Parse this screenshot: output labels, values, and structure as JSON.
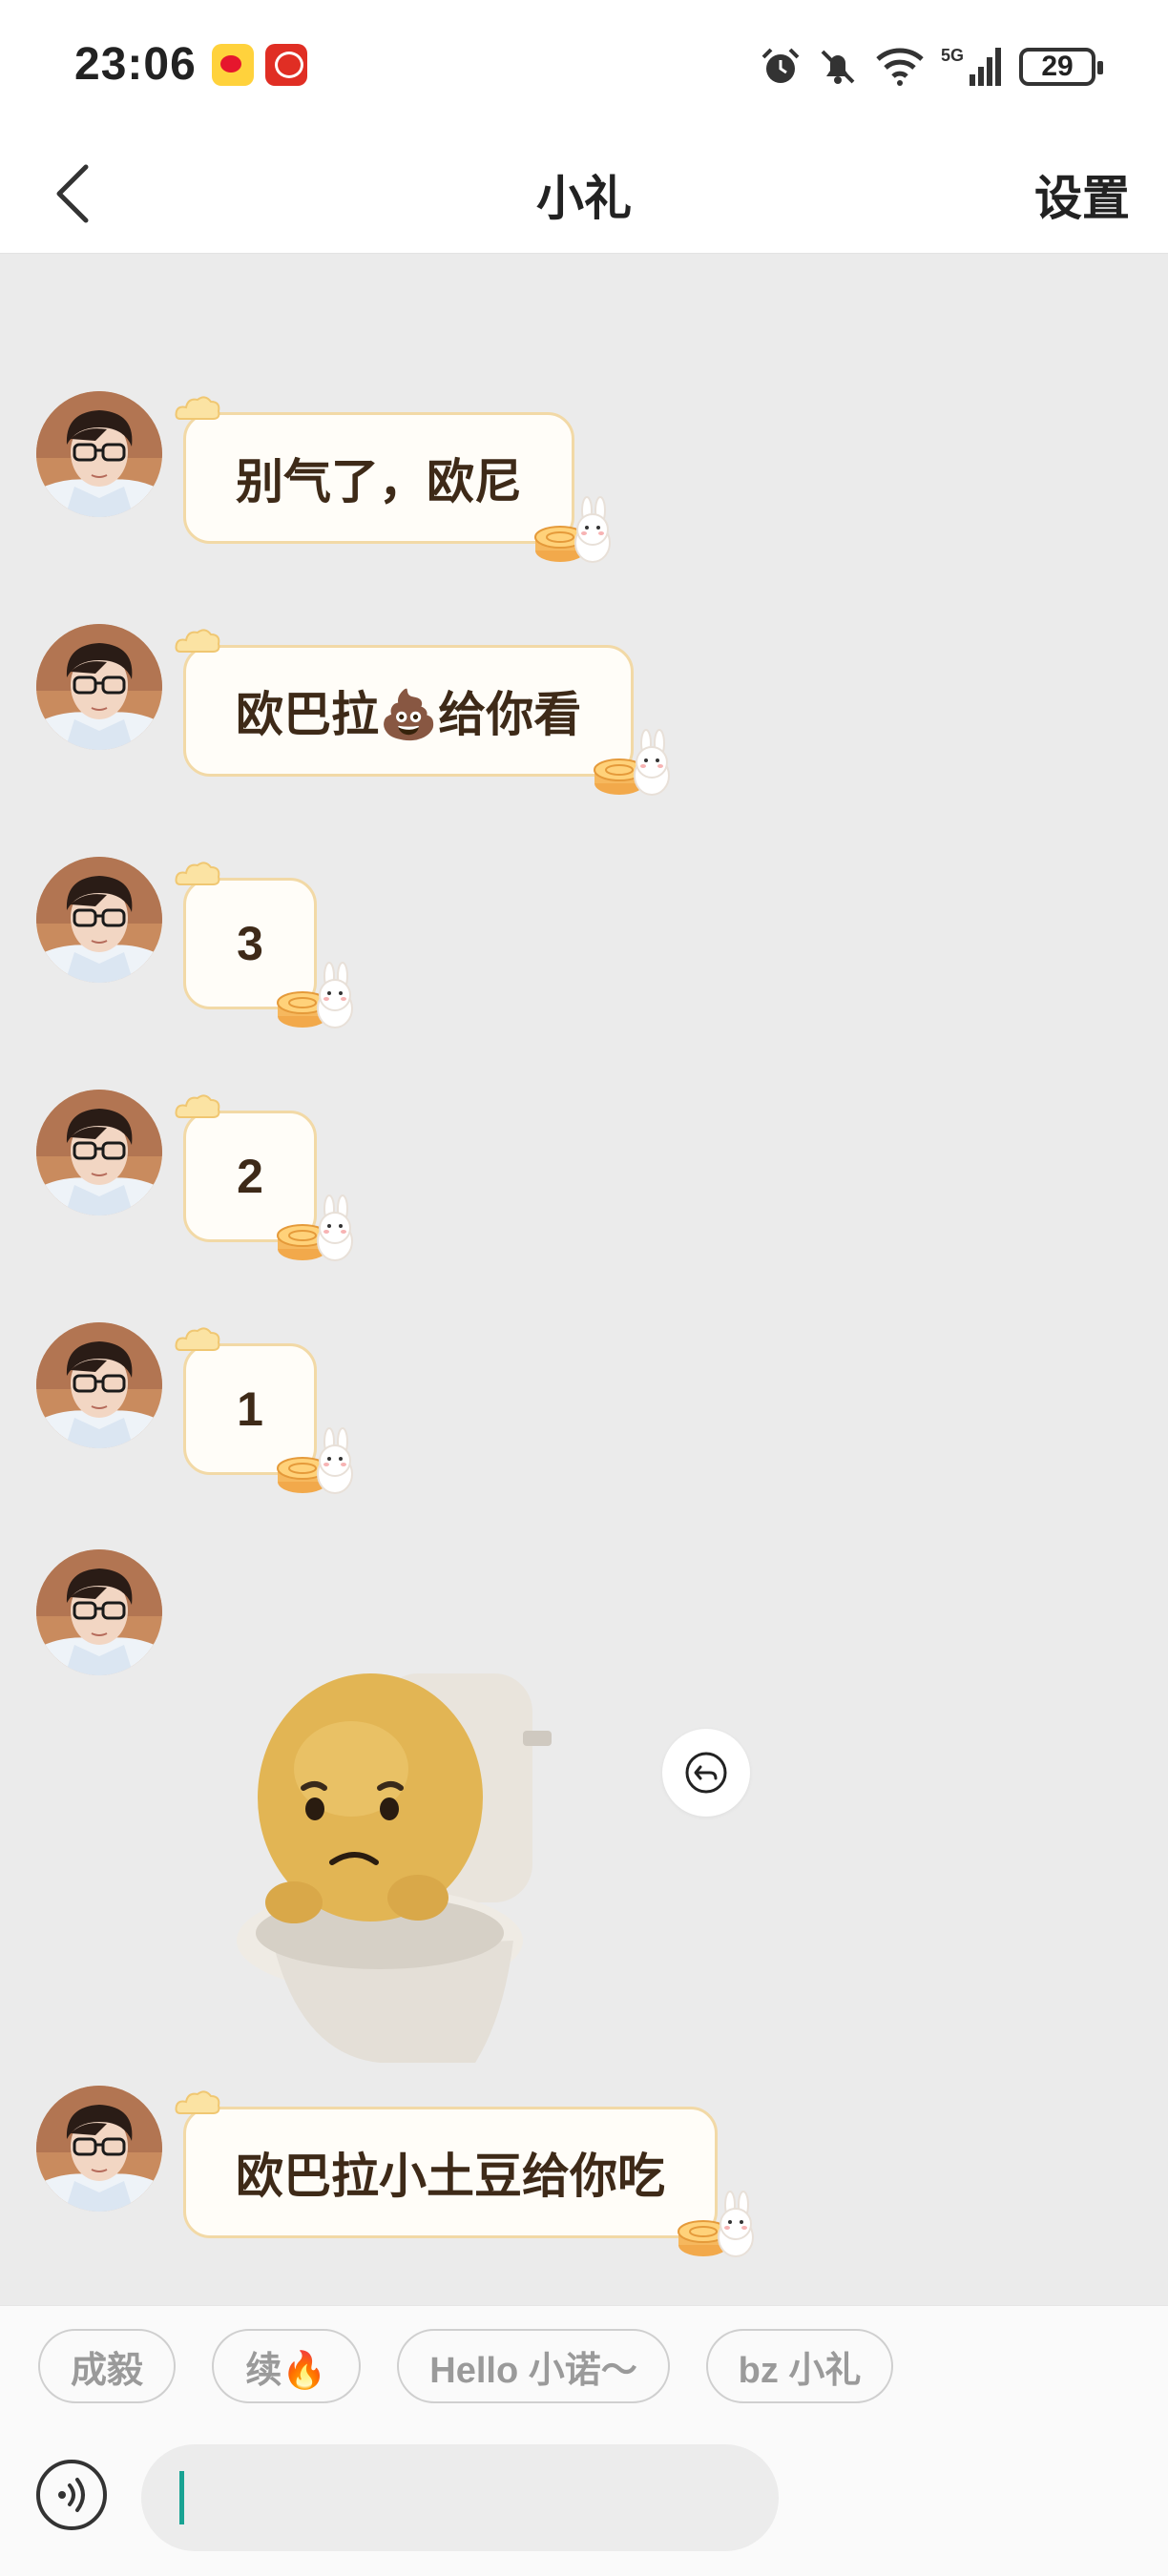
{
  "status_bar": {
    "time": "23:06",
    "battery": "29",
    "network": "5G",
    "notification_icons": [
      "weibo-app-icon",
      "pinduoduo-app-icon"
    ],
    "system_icons": [
      "alarm-icon",
      "mute-icon",
      "wifi-icon",
      "signal-icon",
      "battery-icon"
    ]
  },
  "header": {
    "title": "小礼",
    "settings_label": "设置"
  },
  "messages": [
    {
      "type": "text",
      "text": "别气了，欧尼"
    },
    {
      "type": "text",
      "text": "欧巴拉💩给你看"
    },
    {
      "type": "text",
      "text": "3"
    },
    {
      "type": "text",
      "text": "2"
    },
    {
      "type": "text",
      "text": "1"
    },
    {
      "type": "sticker",
      "sticker": "potato-on-toilet"
    },
    {
      "type": "text",
      "text": "欧巴拉小土豆给你吃"
    }
  ],
  "quick_replies": [
    "成毅",
    "续🔥",
    "Hello 小诺～",
    "bz 小礼"
  ],
  "input": {
    "value": "",
    "placeholder": ""
  },
  "colors": {
    "bubble_bg": "#fffdf8",
    "bubble_border": "#f2d9a6",
    "bubble_text": "#3e2a18",
    "chat_bg": "#ebebeb",
    "caret": "#19a393"
  }
}
